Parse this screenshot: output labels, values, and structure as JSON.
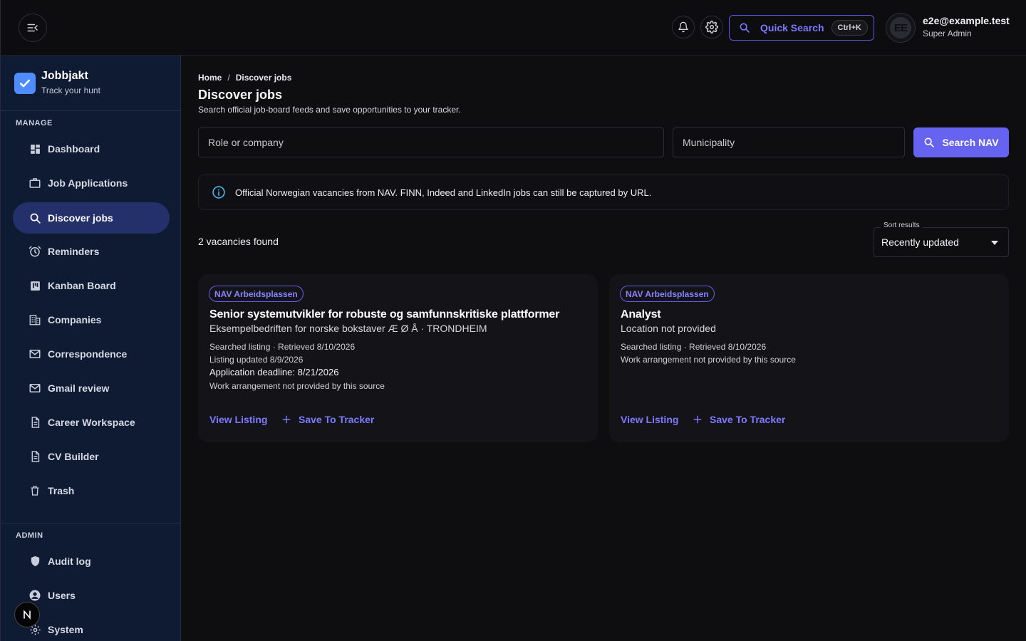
{
  "topbar": {
    "quick_search_label": "Quick Search",
    "quick_search_shortcut": "Ctrl+K",
    "avatar_initials": "EE",
    "user_email": "e2e@example.test",
    "user_role": "Super Admin"
  },
  "sidebar": {
    "brand_name": "Jobbjakt",
    "brand_tagline": "Track your hunt",
    "manage_label": "MANAGE",
    "admin_label": "ADMIN",
    "manage_items": [
      {
        "label": "Dashboard",
        "icon": "dashboard-icon"
      },
      {
        "label": "Job Applications",
        "icon": "briefcase-icon"
      },
      {
        "label": "Discover jobs",
        "icon": "search-icon",
        "active": true
      },
      {
        "label": "Reminders",
        "icon": "alarm-icon"
      },
      {
        "label": "Kanban Board",
        "icon": "kanban-icon"
      },
      {
        "label": "Companies",
        "icon": "building-icon"
      },
      {
        "label": "Correspondence",
        "icon": "mail-icon"
      },
      {
        "label": "Gmail review",
        "icon": "mail-icon"
      },
      {
        "label": "Career Workspace",
        "icon": "document-icon"
      },
      {
        "label": "CV Builder",
        "icon": "document-icon"
      },
      {
        "label": "Trash",
        "icon": "trash-icon"
      }
    ],
    "admin_items": [
      {
        "label": "Audit log",
        "icon": "shield-icon"
      },
      {
        "label": "Users",
        "icon": "user-circle-icon"
      },
      {
        "label": "System",
        "icon": "gear-icon"
      }
    ],
    "fab_letter": "N"
  },
  "main": {
    "breadcrumb": {
      "home": "Home",
      "separator": "/",
      "current": "Discover jobs"
    },
    "title": "Discover jobs",
    "subtitle": "Search official job-board feeds and save opportunities to your tracker.",
    "search": {
      "role_placeholder": "Role or company",
      "municipality_placeholder": "Municipality",
      "button_label": "Search NAV"
    },
    "info_banner": "Official Norwegian vacancies from NAV. FINN, Indeed and LinkedIn jobs can still be captured by URL.",
    "results_count": "2 vacancies found",
    "sort": {
      "label": "Sort results",
      "value": "Recently updated"
    },
    "jobs": [
      {
        "source": "NAV Arbeidsplassen",
        "title": "Senior systemutvikler for robuste og samfunnskritiske plattformer",
        "company": "Eksempelbedriften for norske bokstaver Æ Ø Å · TRONDHEIM",
        "retrieved": "Searched listing · Retrieved 8/10/2026",
        "updated": "Listing updated 8/9/2026",
        "deadline": "Application deadline: 8/21/2026",
        "arrangement": "Work arrangement not provided by this source",
        "view_label": "View Listing",
        "save_label": "Save To Tracker"
      },
      {
        "source": "NAV Arbeidsplassen",
        "title": "Analyst",
        "company": "Location not provided",
        "retrieved": "Searched listing · Retrieved 8/10/2026",
        "arrangement": "Work arrangement not provided by this source",
        "view_label": "View Listing",
        "save_label": "Save To Tracker"
      }
    ]
  },
  "colors": {
    "accent": "#6563f0",
    "sidebar_bg": "#0f1a33",
    "active_nav_bg": "#24306a",
    "page_bg": "#0e0e11",
    "card_bg": "#141418",
    "info_icon": "#4ab4e8"
  }
}
